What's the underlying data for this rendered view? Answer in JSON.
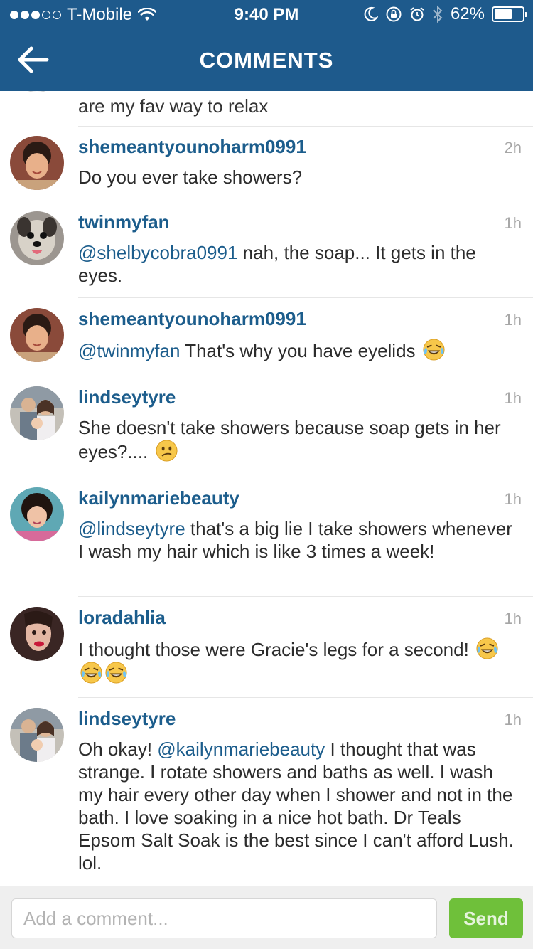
{
  "status_bar": {
    "carrier": "T-Mobile",
    "time": "9:40 PM",
    "battery": "62%",
    "battery_level": 0.62,
    "signal_bars_filled": 3,
    "signal_bars_total": 5
  },
  "header": {
    "title": "COMMENTS",
    "back_icon": "arrow-left-icon",
    "color": "#1e5a8c"
  },
  "partial_comment": {
    "text": "are my fav way to relax"
  },
  "comments": [
    {
      "user": "shemeantyounoharm0991",
      "time": "2h",
      "parts": [
        {
          "text": "Do you ever take showers?"
        }
      ]
    },
    {
      "user": "twinmyfan",
      "time": "1h",
      "parts": [
        {
          "mention": "@shelbycobra0991"
        },
        {
          "text": " nah, the soap... It gets in the eyes."
        }
      ]
    },
    {
      "user": "shemeantyounoharm0991",
      "time": "1h",
      "parts": [
        {
          "mention": "@twinmyfan"
        },
        {
          "text": " That's why you have eyelids "
        },
        {
          "emoji": "laughing-crying"
        }
      ]
    },
    {
      "user": "lindseytyre",
      "time": "1h",
      "parts": [
        {
          "text": "She doesn't take showers because soap gets in her eyes?.... "
        },
        {
          "emoji": "confused"
        }
      ]
    },
    {
      "user": "kailynmariebeauty",
      "time": "1h",
      "parts": [
        {
          "mention": "@lindseytyre"
        },
        {
          "text": " that's a big lie I take showers whenever I wash my hair which is like 3 times a week!"
        }
      ]
    },
    {
      "user": "loradahlia",
      "time": "1h",
      "parts": [
        {
          "text": "I thought those were Gracie's legs for a second! "
        },
        {
          "emoji": "laughing-crying"
        },
        {
          "emoji": "laughing-crying"
        },
        {
          "emoji": "laughing-crying"
        }
      ]
    },
    {
      "user": "lindseytyre",
      "time": "1h",
      "parts": [
        {
          "text": "Oh okay! "
        },
        {
          "mention": "@kailynmariebeauty"
        },
        {
          "text": " I thought that was strange. I rotate showers and baths as well. I wash my hair every other day when I shower and not in the bath. I love soaking in a nice hot bath. Dr Teals Epsom Salt Soak is the best since I can't afford Lush. lol."
        }
      ]
    }
  ],
  "composer": {
    "placeholder": "Add a comment...",
    "send_label": "Send",
    "send_color": "#6fc03a"
  }
}
